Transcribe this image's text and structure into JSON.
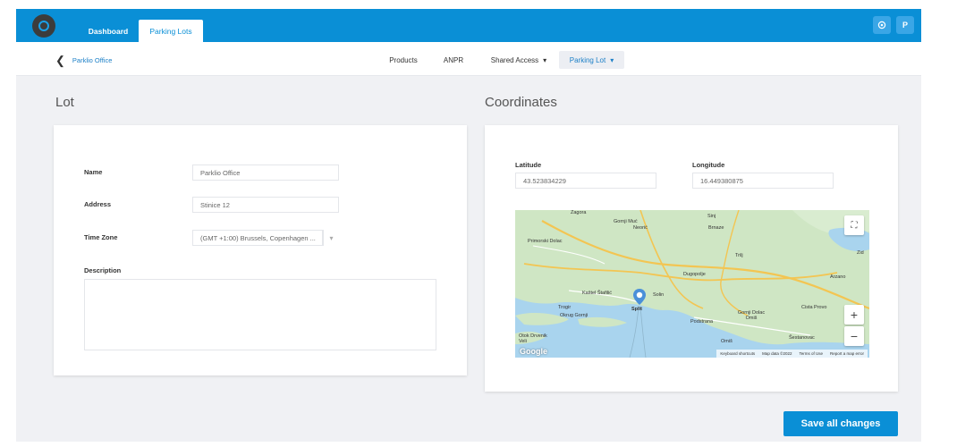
{
  "header": {
    "tabs": [
      {
        "label": "Dashboard"
      },
      {
        "label": "Parking Lots"
      }
    ],
    "user_initial": "P"
  },
  "subnav": {
    "back_label": "Parklio Office",
    "items": [
      {
        "label": "Products"
      },
      {
        "label": "ANPR"
      },
      {
        "label": "Shared Access"
      },
      {
        "label": "Parking Lot"
      }
    ]
  },
  "lot": {
    "title": "Lot",
    "name_label": "Name",
    "name_value": "Parklio Office",
    "address_label": "Address",
    "address_value": "Stinice 12",
    "timezone_label": "Time Zone",
    "timezone_value": "(GMT +1:00) Brussels, Copenhagen ...",
    "description_label": "Description",
    "description_value": ""
  },
  "coordinates": {
    "title": "Coordinates",
    "latitude_label": "Latitude",
    "latitude_value": "43.523834229",
    "longitude_label": "Longitude",
    "longitude_value": "16.449380875"
  },
  "map": {
    "zoom_in": "+",
    "zoom_out": "−",
    "provider": "Google",
    "footer": [
      "Keyboard shortcuts",
      "Map data ©2022",
      "Terms of Use",
      "Report a map error"
    ],
    "places": [
      "Zagora",
      "Gornji Muć",
      "Neorić",
      "Sinj",
      "Brnaze",
      "Primorski Dolac",
      "Trilj",
      "Dugopolje",
      "Kaštel Štafilić",
      "Solin",
      "Split",
      "Trogir",
      "Okrug Gornji",
      "Podstrana",
      "Gornji Dolac Omiš",
      "Cista Provo",
      "Šestanovac",
      "Omiš",
      "Otok Drvenik Veli",
      "Zid",
      "Arzano"
    ],
    "colors": {
      "sea": "#a9d4ee",
      "land": "#cfe6c4",
      "road": "#f3c552"
    }
  },
  "footer": {
    "save_label": "Save all changes"
  },
  "colors": {
    "accent": "#0a8fd6",
    "background": "#f0f1f4"
  }
}
